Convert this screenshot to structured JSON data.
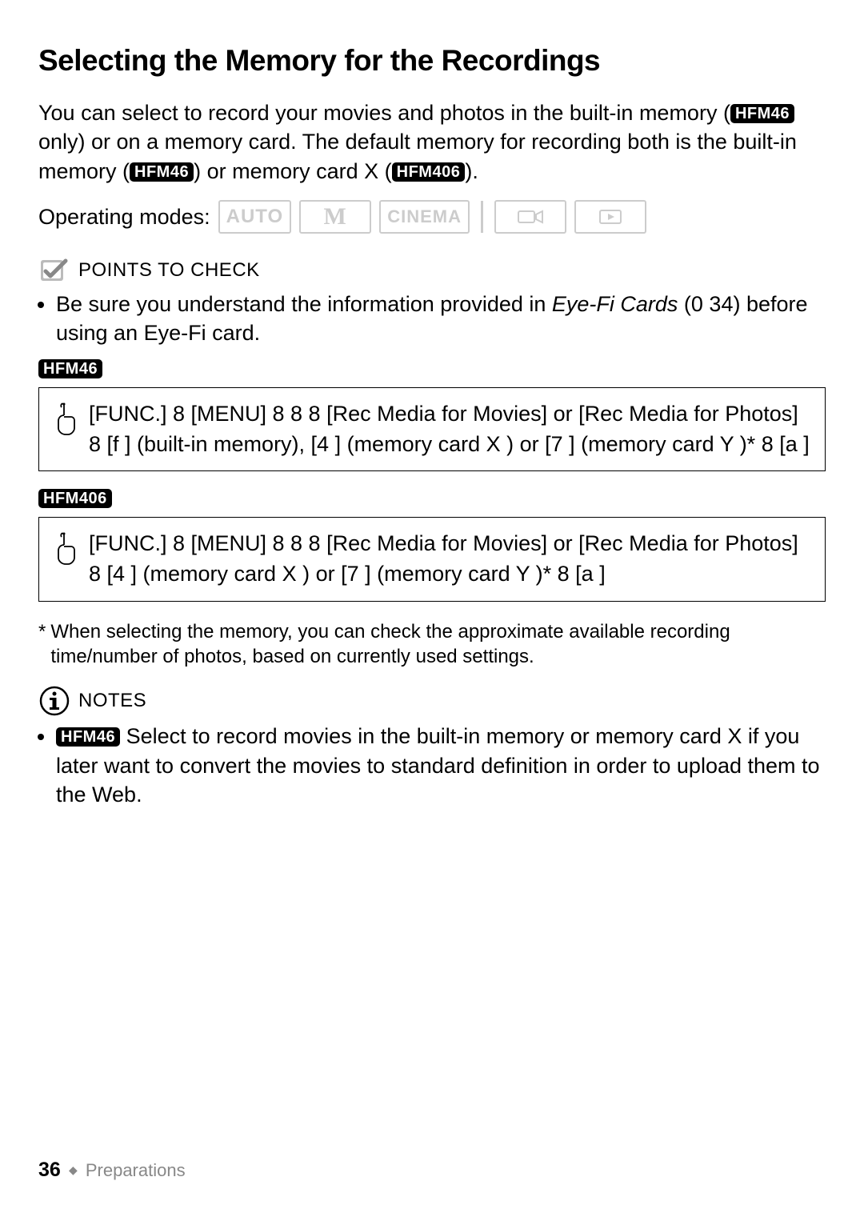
{
  "title": "Selecting the Memory for the Recordings",
  "intro": {
    "part1": "You can select to record your movies and photos in the built-in memory (",
    "pill1": "HFM46",
    "part2": " only) or on a memory card. The default memory for recording both is the built-in memory (",
    "pill2": "HFM46",
    "part3": ") or memory card X   (",
    "pill3": "HFM406",
    "part4": ")."
  },
  "operating_modes_label": "Operating modes:",
  "modes": {
    "auto": "AUTO",
    "m": "M",
    "cinema": "CINEMA"
  },
  "points_to_check": {
    "label": "POINTS TO CHECK",
    "bullet_pre": "Be sure you understand the information provided in ",
    "bullet_em": "Eye-Fi Cards",
    "bullet_post": " (0   34) before using an Eye-Fi card."
  },
  "model1": {
    "tag": "HFM46",
    "text": "[FUNC.] 8   [MENU] 8   8         8   [Rec Media for Movies] or [Rec Media for Photos] 8   [f   ] (built-in memory), [4   ] (memory card X  ) or [7   ] (memory card Y  )* 8   [a   ]"
  },
  "model2": {
    "tag": "HFM406",
    "text": "[FUNC.] 8   [MENU] 8   8         8   [Rec Media for Movies] or [Rec Media for Photos] 8   [4   ] (memory card X  ) or [7   ] (memory card Y  )* 8   [a   ]"
  },
  "footnote": "When selecting the memory, you can check the approximate available recording time/number of photos, based on currently used settings.",
  "notes": {
    "label": "NOTES",
    "pill": "HFM46",
    "text": " Select to record movies in the built-in memory or memory card X   if you later want to convert the movies to standard definition in order to upload them to the Web."
  },
  "footer": {
    "page": "36",
    "chapter": "Preparations"
  }
}
